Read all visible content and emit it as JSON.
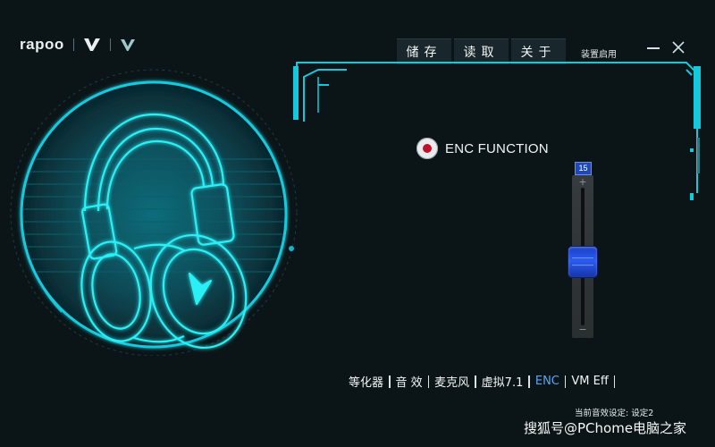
{
  "brand": {
    "name": "rapoo"
  },
  "toolbar": {
    "buttons": [
      "储存",
      "读取",
      "关于"
    ],
    "apply_label": "装置启用"
  },
  "panel": {
    "enc_label": "ENC FUNCTION",
    "enc_enabled": true,
    "slider": {
      "value": 15,
      "min": 0,
      "max": 15,
      "fraction": 0.55
    }
  },
  "tabs": [
    {
      "label": "等化器",
      "active": false
    },
    {
      "label": "音  效",
      "active": false
    },
    {
      "label": "麦克风",
      "active": false
    },
    {
      "label": "虚拟7.1",
      "active": false
    },
    {
      "label": "ENC",
      "active": true
    },
    {
      "label": "VM Eff",
      "active": false
    }
  ],
  "status_text": "当前音效设定: 设定2",
  "watermark": "搜狐号@PChome电脑之家",
  "colors": {
    "accent": "#19d6e6",
    "slider_blue": "#2a5cf0",
    "bg": "#0b1518",
    "active_tab": "#5aa6f0"
  },
  "icons": [
    "v-logo-icon",
    "headset-icon",
    "minimize-icon",
    "close-icon"
  ]
}
